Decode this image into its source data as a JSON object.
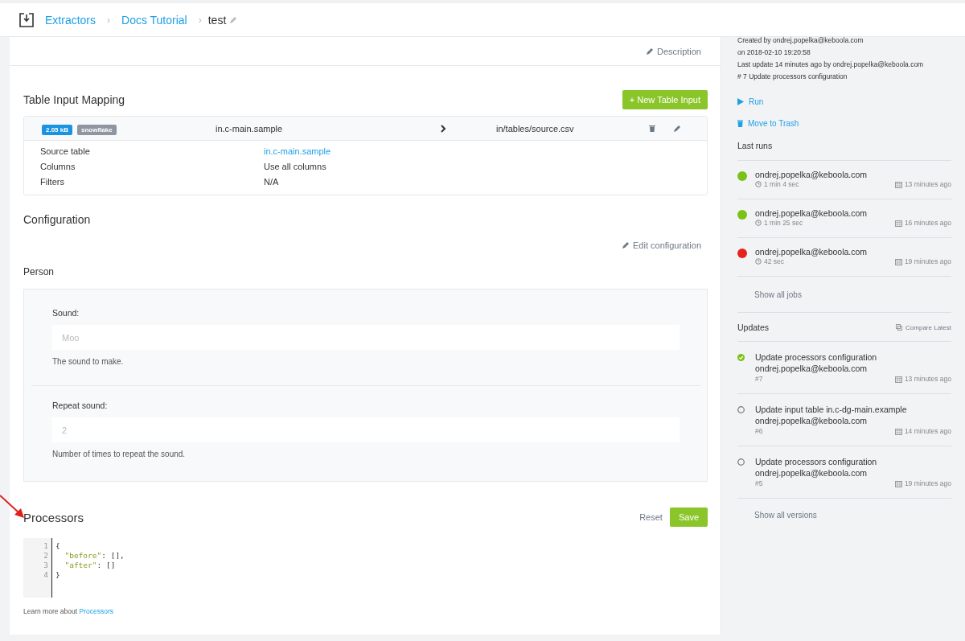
{
  "header": {
    "breadcrumb": [
      {
        "label": "Extractors"
      },
      {
        "label": "Docs Tutorial"
      }
    ],
    "separator": "›",
    "current": "test"
  },
  "description_link": "Description",
  "input_mapping": {
    "title": "Table Input Mapping",
    "add_button": "+ New Table Input",
    "row": {
      "size_badge": "2.05 kB",
      "backend_badge": "snowflake",
      "source": "in.c-main.sample",
      "destination": "in/tables/source.csv"
    },
    "details": [
      {
        "label": "Source table",
        "value": "in.c-main.sample",
        "kind": "link"
      },
      {
        "label": "Columns",
        "value": "Use all columns",
        "kind": "text"
      },
      {
        "label": "Filters",
        "value": "N/A",
        "kind": "text"
      }
    ]
  },
  "configuration": {
    "title": "Configuration",
    "edit_link": "Edit configuration",
    "section": "Person",
    "fields": [
      {
        "label": "Sound:",
        "placeholder": "Moo",
        "help": "The sound to make."
      },
      {
        "label": "Repeat sound:",
        "placeholder": "2",
        "help": "Number of times to repeat the sound."
      }
    ]
  },
  "processors": {
    "title": "Processors",
    "reset": "Reset",
    "save": "Save",
    "code": [
      {
        "number": "1",
        "text": "{"
      },
      {
        "number": "2",
        "text": "  \"before\": [],"
      },
      {
        "number": "3",
        "text": "  \"after\": []"
      },
      {
        "number": "4",
        "text": "}"
      }
    ],
    "learn_more": "Learn more about",
    "learn_link": "Processors"
  },
  "sidebar": {
    "info": [
      "Created by ondrej.popelka@keboola.com",
      "on 2018-02-10 19:20:58",
      "Last update 14 minutes ago by ondrej.popelka@keboola.com",
      "# 7 Update processors configuration"
    ],
    "actions": [
      {
        "label": "Run",
        "kind": "run"
      },
      {
        "label": "Move to Trash",
        "kind": "trash"
      }
    ],
    "last_runs_title": "Last runs",
    "runs": [
      {
        "user": "ondrej.popelka@keboola.com",
        "duration": "1 min 4 sec",
        "time": "13 minutes ago",
        "color": "#7ac215"
      },
      {
        "user": "ondrej.popelka@keboola.com",
        "duration": "1 min 25 sec",
        "time": "16 minutes ago",
        "color": "#7ac215"
      },
      {
        "user": "ondrej.popelka@keboola.com",
        "duration": "42 sec",
        "time": "19 minutes ago",
        "color": "#e5231b"
      }
    ],
    "show_jobs": "Show all jobs",
    "updates_title": "Updates",
    "compare": "Compare Latest",
    "updates": [
      {
        "title": "Update processors configuration",
        "user": "ondrej.popelka@keboola.com",
        "version": "#7",
        "time": "13 minutes ago",
        "selected": true
      },
      {
        "title": "Update input table in.c-dg-main.example",
        "user": "ondrej.popelka@keboola.com",
        "version": "#6",
        "time": "14 minutes ago",
        "selected": false
      },
      {
        "title": "Update processors configuration",
        "user": "ondrej.popelka@keboola.com",
        "version": "#5",
        "time": "19 minutes ago",
        "selected": false
      }
    ],
    "show_versions": "Show all versions"
  }
}
